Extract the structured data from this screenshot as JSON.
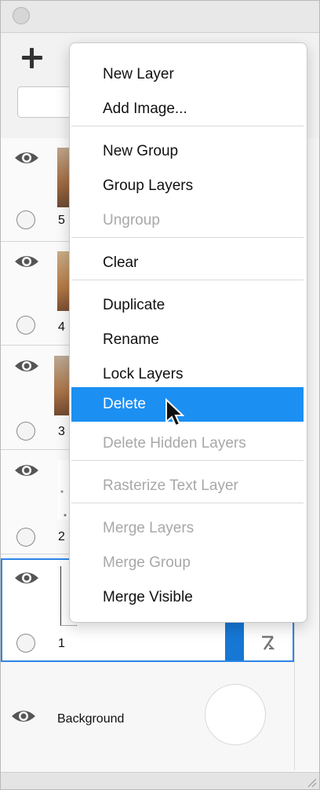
{
  "layers": [
    {
      "name": "5"
    },
    {
      "name": "4"
    },
    {
      "name": "3"
    },
    {
      "name": "2"
    },
    {
      "name": "1",
      "selected": true
    }
  ],
  "background_layer": {
    "name": "Background"
  },
  "context_menu": {
    "items": [
      {
        "label": "New Layer",
        "enabled": true
      },
      {
        "label": "Add Image...",
        "enabled": true
      },
      {
        "label": "New Group",
        "enabled": true
      },
      {
        "label": "Group Layers",
        "enabled": true
      },
      {
        "label": "Ungroup",
        "enabled": false
      },
      {
        "label": "Clear",
        "enabled": true
      },
      {
        "label": "Duplicate",
        "enabled": true
      },
      {
        "label": "Rename",
        "enabled": true
      },
      {
        "label": "Lock Layers",
        "enabled": true
      },
      {
        "label": "Delete",
        "enabled": true,
        "highlighted": true
      },
      {
        "label": "Delete Hidden Layers",
        "enabled": false
      },
      {
        "label": "Rasterize Text Layer",
        "enabled": false
      },
      {
        "label": "Merge Layers",
        "enabled": false
      },
      {
        "label": "Merge Group",
        "enabled": false
      },
      {
        "label": "Merge Visible",
        "enabled": true
      }
    ]
  },
  "colors": {
    "highlight": "#1c8ff2",
    "selection_border": "#2c86e8",
    "disabled_text": "#a8a8a8"
  }
}
